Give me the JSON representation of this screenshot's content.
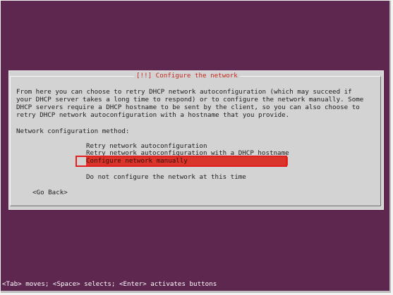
{
  "dialog": {
    "title": "[!!] Configure the network",
    "description": [
      "From here you can choose to retry DHCP network autoconfiguration (which may succeed if",
      "your DHCP server takes a long time to respond) or to configure the network manually. Some",
      "DHCP servers require a DHCP hostname to be sent by the client, so you can also choose to",
      "retry DHCP network autoconfiguration with a hostname that you provide."
    ],
    "prompt": "Network configuration method:",
    "options": [
      "Retry network autoconfiguration",
      "Retry network autoconfiguration with a DHCP hostname",
      "Configure network manually",
      "Do not configure the network at this time"
    ],
    "selected_option": "Configure network manually",
    "go_back_label": "<Go Back>"
  },
  "status_bar": {
    "text": "<Tab> moves; <Space> selects; <Enter> activates buttons"
  },
  "colors": {
    "background": "#5e2750",
    "dialog": "#d3d3d3",
    "title": "#c4281c",
    "selection": "#d9352a",
    "annotation_box": "#e21e1e"
  }
}
